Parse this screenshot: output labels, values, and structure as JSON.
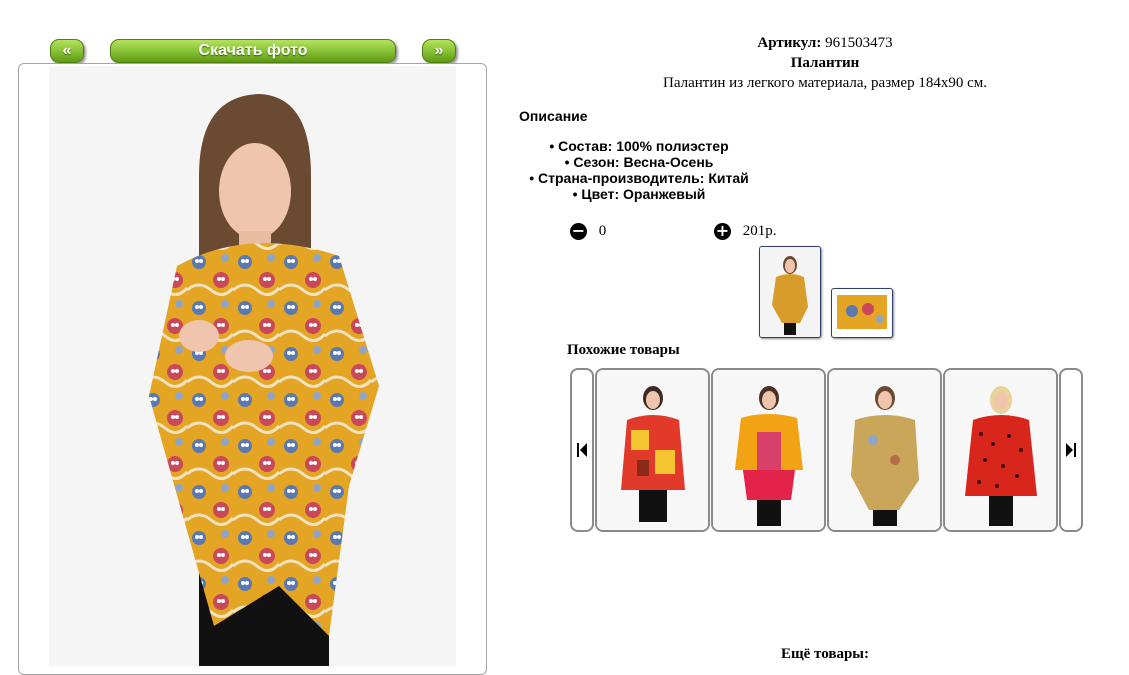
{
  "nav": {
    "prev_label": "«",
    "download_label": "Скачать фото",
    "next_label": "»"
  },
  "product": {
    "article_label": "Артикул:",
    "article_value": "961503473",
    "name": "Палантин",
    "subtitle": "Палантин из легкого материала, размер 184x90 см."
  },
  "description": {
    "heading": "Описание",
    "specs": [
      "Состав: 100% полиэстер",
      "Сезон: Весна-Осень",
      "Страна-производитель: Китай",
      "Цвет: Оранжевый"
    ]
  },
  "cart": {
    "quantity": "0",
    "price": "201р."
  },
  "similar": {
    "title": "Похожие товары"
  },
  "more": {
    "title": "Ещё товары:"
  },
  "colors": {
    "button_green": "#8cc63a",
    "scarf_orange": "#e0a020",
    "border_gray": "#8a8a8a"
  }
}
